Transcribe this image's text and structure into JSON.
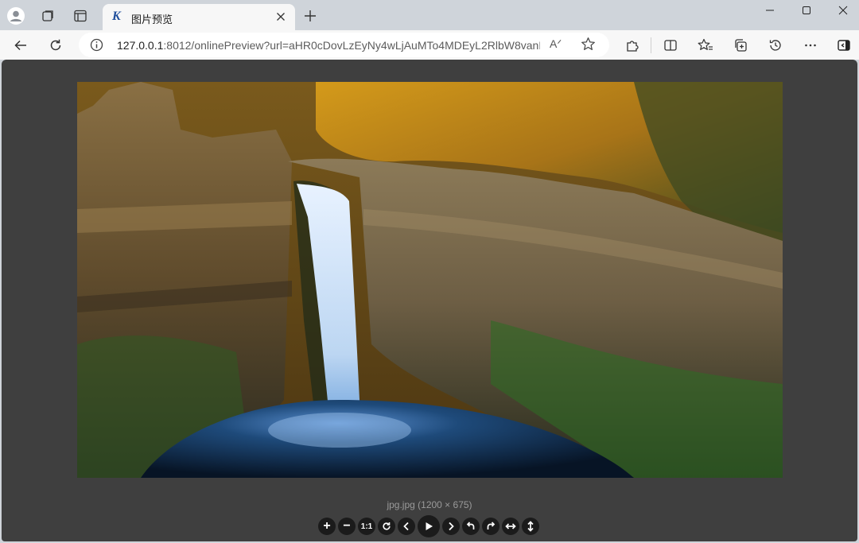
{
  "browser": {
    "tab": {
      "favicon_letter": "K",
      "title": "图片预览"
    },
    "address": {
      "url_host": "127.0.0.1",
      "url_rest": ":8012/onlinePreview?url=aHR0cDovLzEyNy4wLjAuMTo4MDEyL2RlbW8vanB..."
    },
    "icons": {
      "profile": "profile-icon",
      "collections": "workspaces-icon",
      "tab_actions": "tab-actions-icon",
      "back": "back-arrow-icon",
      "refresh": "refresh-icon",
      "info": "info-icon",
      "read_aloud": "read-aloud-icon",
      "favorite": "star-icon",
      "extensions": "puzzle-icon",
      "split": "split-screen-icon",
      "favorites": "favorites-icon",
      "collections_tb": "collections-icon",
      "history": "history-icon",
      "more": "more-icon",
      "sidebar": "sidebar-icon"
    },
    "read_aloud_glyph": "Aᐟ"
  },
  "viewer": {
    "caption": "jpg.jpg (1200 × 675)",
    "image_alt": "waterfall landscape",
    "controls": {
      "zoom_in": "+",
      "zoom_out": "−",
      "one_to_one": "1:1",
      "reset": "reset",
      "prev": "prev",
      "play": "play",
      "next": "next",
      "rotate_left": "rotate-left",
      "rotate_right": "rotate-right",
      "flip_horizontal": "flip-horizontal",
      "flip_vertical": "flip-vertical"
    }
  },
  "colors": {
    "viewer_bg": "#3f3f3f",
    "control_bg": "#1b1b1b",
    "chrome_bg": "#cfd4da",
    "toolbar_bg": "#f7f7f7"
  }
}
